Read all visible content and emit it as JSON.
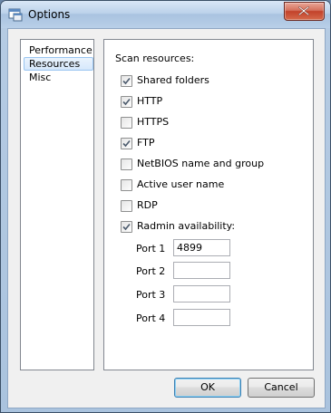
{
  "window": {
    "title": "Options"
  },
  "nav": {
    "items": [
      {
        "label": "Performance",
        "selected": false
      },
      {
        "label": "Resources",
        "selected": true
      },
      {
        "label": "Misc",
        "selected": false
      }
    ]
  },
  "resources": {
    "section_label": "Scan resources:",
    "options": [
      {
        "label": "Shared folders",
        "checked": true
      },
      {
        "label": "HTTP",
        "checked": true
      },
      {
        "label": "HTTPS",
        "checked": false
      },
      {
        "label": "FTP",
        "checked": true
      },
      {
        "label": "NetBIOS name and group",
        "checked": false
      },
      {
        "label": "Active user name",
        "checked": false
      },
      {
        "label": "RDP",
        "checked": false
      },
      {
        "label": "Radmin availability:",
        "checked": true
      }
    ],
    "ports": [
      {
        "label": "Port 1",
        "value": "4899"
      },
      {
        "label": "Port 2",
        "value": ""
      },
      {
        "label": "Port 3",
        "value": ""
      },
      {
        "label": "Port 4",
        "value": ""
      }
    ]
  },
  "buttons": {
    "ok": "OK",
    "cancel": "Cancel"
  },
  "colors": {
    "title_gradient": "#bcd2ea",
    "close_button": "#c2412a",
    "selection": "#d6e8fb"
  },
  "icons": {
    "app": "options-window-icon",
    "close": "close-icon",
    "check": "checkmark-icon"
  }
}
